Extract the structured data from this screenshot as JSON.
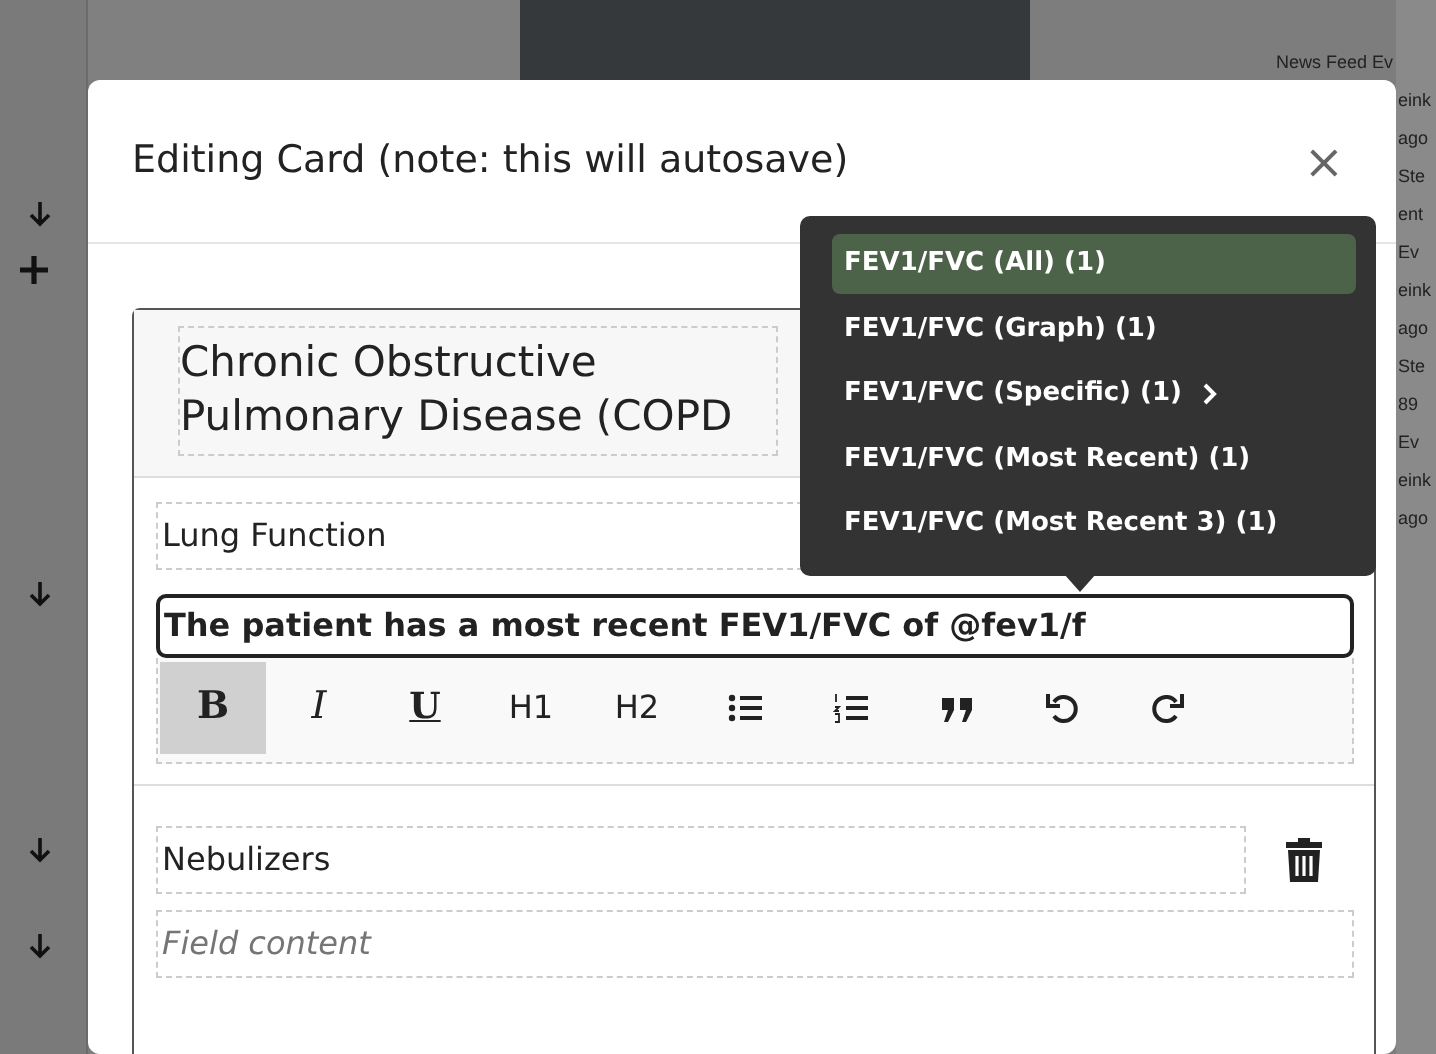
{
  "background": {
    "left_marks": [
      {
        "kind": "arrow"
      },
      {
        "kind": "plus"
      },
      {
        "kind": "arrow"
      },
      {
        "kind": "arrow"
      },
      {
        "kind": "arrow"
      }
    ],
    "right_texts": [
      "News Feed Ev",
      "eink",
      "ago",
      "Ste",
      "ent",
      "Ev",
      "eink",
      "ago",
      "Ste",
      "89",
      "Ev",
      "eink",
      "ago"
    ]
  },
  "modal": {
    "title": "Editing Card (note: this will autosave)",
    "close": "×"
  },
  "card": {
    "title": "Chronic Obstructive Pulmonary Disease (COPD",
    "section": {
      "label": "Lung Function",
      "editor_text": "The patient has a most recent FEV1/FVC of @fev1/f",
      "toolbar": [
        {
          "kind": "text",
          "label": "B",
          "active": true
        },
        {
          "kind": "text",
          "label": "I",
          "active": false
        },
        {
          "kind": "text",
          "label": "U",
          "active": false
        },
        {
          "kind": "text",
          "label": "H1",
          "active": false
        },
        {
          "kind": "text",
          "label": "H2",
          "active": false
        },
        {
          "kind": "icon",
          "active": false
        },
        {
          "kind": "icon",
          "active": false
        },
        {
          "kind": "icon",
          "active": false
        },
        {
          "kind": "icon",
          "active": false
        },
        {
          "kind": "icon",
          "active": false
        }
      ]
    },
    "second_section": {
      "label": "Nebulizers",
      "placeholder": "Field content"
    }
  },
  "dropdown": {
    "items": [
      {
        "label": "FEV1/FVC (All) (1)",
        "selected": true,
        "submenu": false
      },
      {
        "label": "FEV1/FVC (Graph) (1)",
        "selected": false,
        "submenu": false
      },
      {
        "label": "FEV1/FVC (Specific) (1)",
        "selected": false,
        "submenu": true
      },
      {
        "label": "FEV1/FVC (Most Recent) (1)",
        "selected": false,
        "submenu": false
      },
      {
        "label": "FEV1/FVC (Most Recent 3) (1)",
        "selected": false,
        "submenu": false
      }
    ]
  }
}
